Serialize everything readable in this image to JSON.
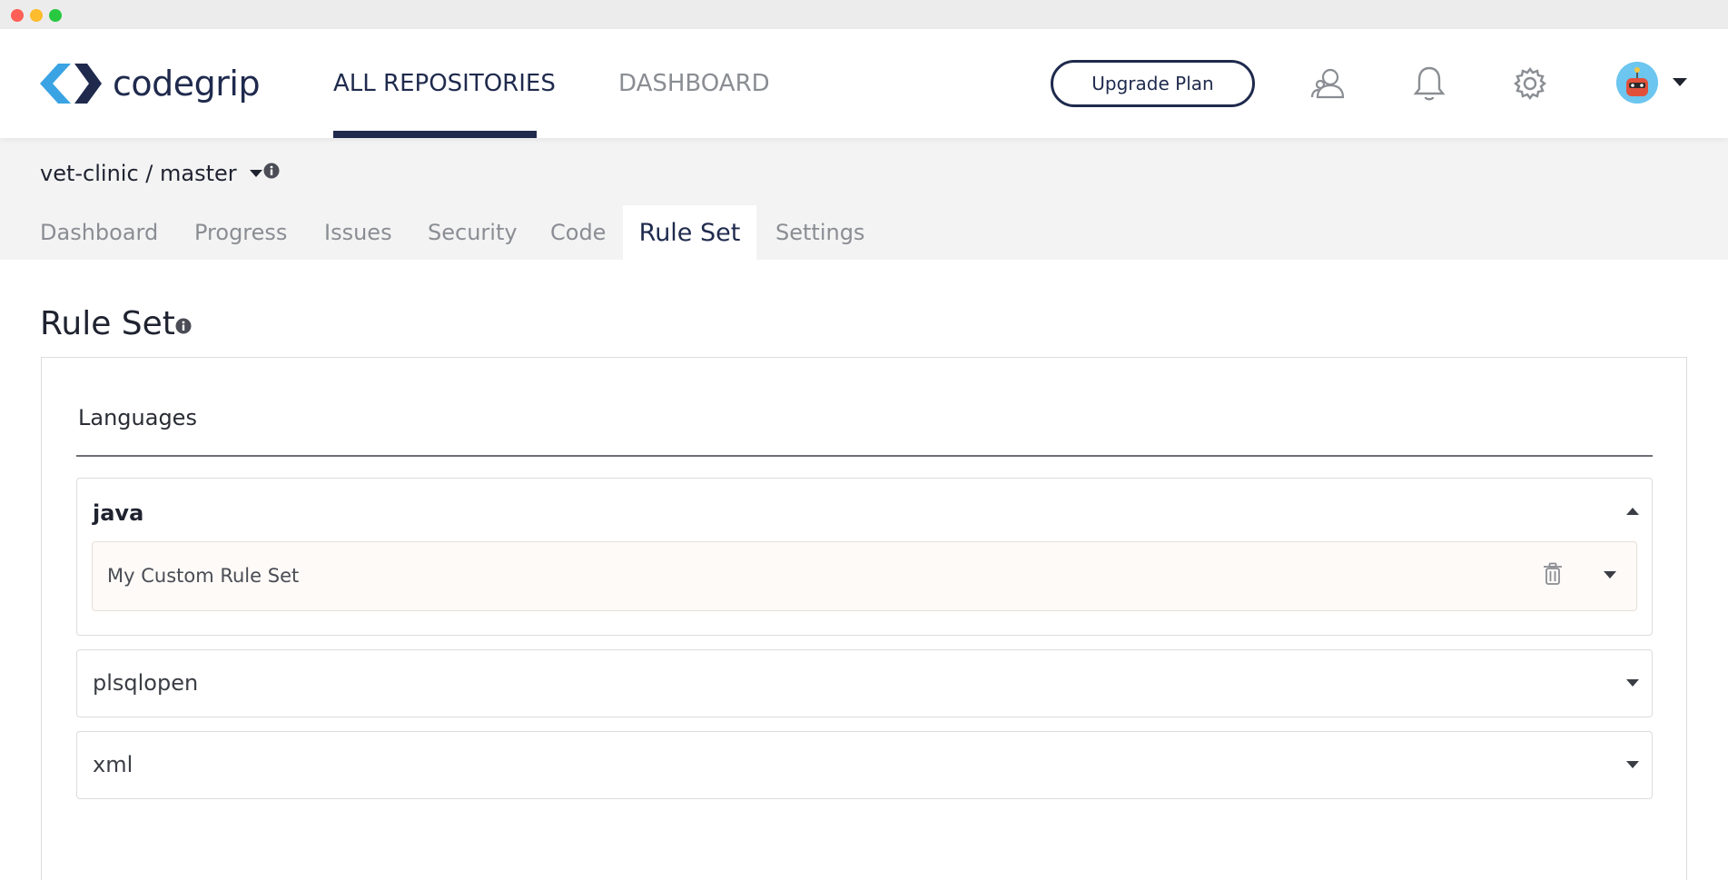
{
  "window": {
    "dots": [
      "#ff5f57",
      "#febc2e",
      "#28c840"
    ]
  },
  "header": {
    "logo_text": "codegrip",
    "nav": [
      {
        "label": "ALL REPOSITORIES",
        "active": true
      },
      {
        "label": "DASHBOARD",
        "active": false
      }
    ],
    "upgrade_label": "Upgrade Plan",
    "icons": [
      "users-icon",
      "bell-icon",
      "gear-icon",
      "avatar",
      "caret-down-icon"
    ]
  },
  "repo": {
    "breadcrumb": "vet-clinic / master"
  },
  "tabs": [
    {
      "label": "Dashboard"
    },
    {
      "label": "Progress"
    },
    {
      "label": "Issues"
    },
    {
      "label": "Security"
    },
    {
      "label": "Code"
    },
    {
      "label": "Rule Set",
      "active": true
    },
    {
      "label": "Settings"
    }
  ],
  "page": {
    "title": "Rule Set",
    "section_label": "Languages"
  },
  "languages": [
    {
      "name": "java",
      "expanded": true,
      "rulesets": [
        {
          "name": "My Custom Rule Set"
        }
      ]
    },
    {
      "name": "plsqlopen",
      "expanded": false
    },
    {
      "name": "xml",
      "expanded": false
    }
  ],
  "colors": {
    "brand_navy": "#1f2a4d",
    "brand_blue": "#3aa3e3",
    "muted_text": "#8a8d93",
    "subbar_bg": "#f3f3f3"
  }
}
